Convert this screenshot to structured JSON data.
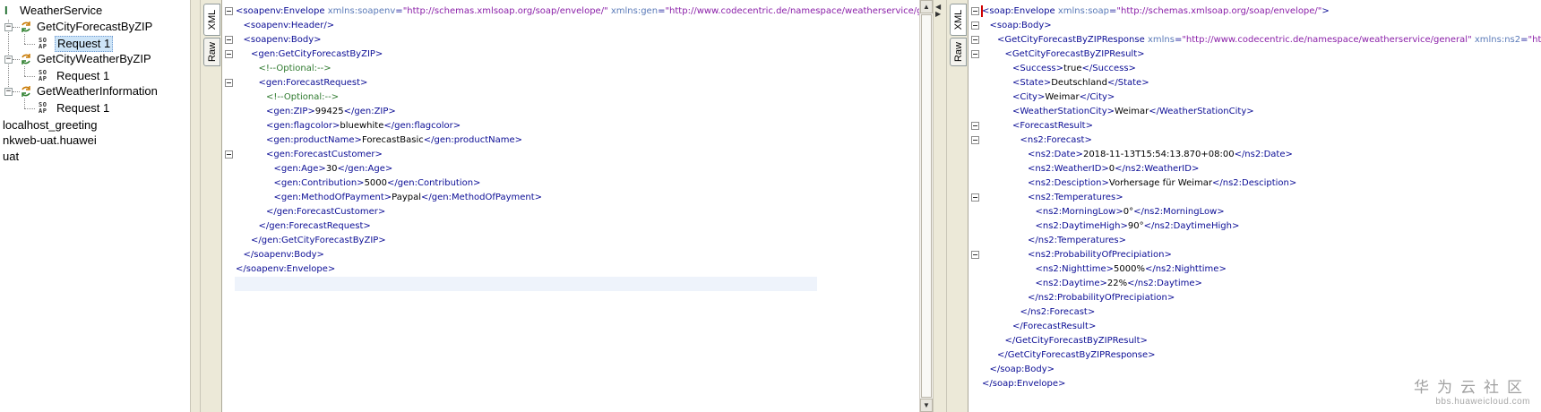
{
  "navigator": {
    "service": "WeatherService",
    "operations": [
      {
        "name": "GetCityForecastByZIP",
        "request": "Request 1",
        "selected": true
      },
      {
        "name": "GetCityWeatherByZIP",
        "request": "Request 1",
        "selected": false
      },
      {
        "name": "GetWeatherInformation",
        "request": "Request 1",
        "selected": false
      }
    ],
    "projects": [
      "localhost_greeting",
      "nkweb-uat.huawei",
      "uat"
    ],
    "icons": {
      "service": "service-icon",
      "operation": "operation-icon",
      "request": "soap-request-icon"
    }
  },
  "tabs": {
    "xml": "XML",
    "raw": "Raw"
  },
  "request_xml": [
    {
      "indent": 0,
      "fold": true,
      "parts": [
        [
          "t",
          "<soapenv:Envelope "
        ],
        [
          "an",
          "xmlns:soapenv"
        ],
        [
          "t",
          "="
        ],
        [
          "av",
          "\"http://schemas.xmlsoap.org/soap/envelope/\""
        ],
        [
          "tx",
          " "
        ],
        [
          "an",
          "xmlns:gen"
        ],
        [
          "t",
          "="
        ],
        [
          "av",
          "\"http://www.codecentric.de/namespace/weatherservice/general"
        ]
      ]
    },
    {
      "indent": 1,
      "fold": false,
      "parts": [
        [
          "t",
          "<soapenv:Header/>"
        ]
      ]
    },
    {
      "indent": 1,
      "fold": true,
      "parts": [
        [
          "t",
          "<soapenv:Body>"
        ]
      ]
    },
    {
      "indent": 2,
      "fold": true,
      "parts": [
        [
          "t",
          "<gen:GetCityForecastByZIP>"
        ]
      ]
    },
    {
      "indent": 3,
      "fold": false,
      "parts": [
        [
          "cm",
          "<!--Optional:-->"
        ]
      ]
    },
    {
      "indent": 3,
      "fold": true,
      "parts": [
        [
          "t",
          "<gen:ForecastRequest>"
        ]
      ]
    },
    {
      "indent": 4,
      "fold": false,
      "parts": [
        [
          "cm",
          "<!--Optional:-->"
        ]
      ]
    },
    {
      "indent": 4,
      "fold": false,
      "parts": [
        [
          "t",
          "<gen:ZIP>"
        ],
        [
          "tx",
          "99425"
        ],
        [
          "t",
          "</gen:ZIP>"
        ]
      ]
    },
    {
      "indent": 4,
      "fold": false,
      "parts": [
        [
          "t",
          "<gen:flagcolor>"
        ],
        [
          "tx",
          "bluewhite"
        ],
        [
          "t",
          "</gen:flagcolor>"
        ]
      ]
    },
    {
      "indent": 4,
      "fold": false,
      "parts": [
        [
          "t",
          "<gen:productName>"
        ],
        [
          "tx",
          "ForecastBasic"
        ],
        [
          "t",
          "</gen:productName>"
        ]
      ]
    },
    {
      "indent": 4,
      "fold": true,
      "parts": [
        [
          "t",
          "<gen:ForecastCustomer>"
        ]
      ]
    },
    {
      "indent": 5,
      "fold": false,
      "parts": [
        [
          "t",
          "<gen:Age>"
        ],
        [
          "tx",
          "30"
        ],
        [
          "t",
          "</gen:Age>"
        ]
      ]
    },
    {
      "indent": 5,
      "fold": false,
      "parts": [
        [
          "t",
          "<gen:Contribution>"
        ],
        [
          "tx",
          "5000"
        ],
        [
          "t",
          "</gen:Contribution>"
        ]
      ]
    },
    {
      "indent": 5,
      "fold": false,
      "parts": [
        [
          "t",
          "<gen:MethodOfPayment>"
        ],
        [
          "tx",
          "Paypal"
        ],
        [
          "t",
          "</gen:MethodOfPayment>"
        ]
      ]
    },
    {
      "indent": 4,
      "fold": false,
      "parts": [
        [
          "t",
          "</gen:ForecastCustomer>"
        ]
      ]
    },
    {
      "indent": 3,
      "fold": false,
      "parts": [
        [
          "t",
          "</gen:ForecastRequest>"
        ]
      ]
    },
    {
      "indent": 2,
      "fold": false,
      "parts": [
        [
          "t",
          "</gen:GetCityForecastByZIP>"
        ]
      ]
    },
    {
      "indent": 1,
      "fold": false,
      "parts": [
        [
          "t",
          "</soapenv:Body>"
        ]
      ]
    },
    {
      "indent": 0,
      "fold": false,
      "parts": [
        [
          "t",
          "</soapenv:Envelope>"
        ]
      ]
    }
  ],
  "response_xml": [
    {
      "indent": 0,
      "fold": true,
      "parts": [
        [
          "t",
          "<soap:Envelope "
        ],
        [
          "an",
          "xmlns:soap"
        ],
        [
          "t",
          "="
        ],
        [
          "av",
          "\"http://schemas.xmlsoap.org/soap/envelope/\""
        ],
        [
          "t",
          ">"
        ]
      ]
    },
    {
      "indent": 1,
      "fold": true,
      "parts": [
        [
          "t",
          "<soap:Body>"
        ]
      ]
    },
    {
      "indent": 2,
      "fold": true,
      "parts": [
        [
          "t",
          "<GetCityForecastByZIPResponse "
        ],
        [
          "an",
          "xmlns"
        ],
        [
          "t",
          "="
        ],
        [
          "av",
          "\"http://www.codecentric.de/namespace/weatherservice/general\""
        ],
        [
          "tx",
          " "
        ],
        [
          "an",
          "xmlns:ns2"
        ],
        [
          "t",
          "="
        ],
        [
          "av",
          "\"http://"
        ]
      ]
    },
    {
      "indent": 3,
      "fold": true,
      "parts": [
        [
          "t",
          "<GetCityForecastByZIPResult>"
        ]
      ]
    },
    {
      "indent": 4,
      "fold": false,
      "parts": [
        [
          "t",
          "<Success>"
        ],
        [
          "tx",
          "true"
        ],
        [
          "t",
          "</Success>"
        ]
      ]
    },
    {
      "indent": 4,
      "fold": false,
      "parts": [
        [
          "t",
          "<State>"
        ],
        [
          "tx",
          "Deutschland"
        ],
        [
          "t",
          "</State>"
        ]
      ]
    },
    {
      "indent": 4,
      "fold": false,
      "parts": [
        [
          "t",
          "<City>"
        ],
        [
          "tx",
          "Weimar"
        ],
        [
          "t",
          "</City>"
        ]
      ]
    },
    {
      "indent": 4,
      "fold": false,
      "parts": [
        [
          "t",
          "<WeatherStationCity>"
        ],
        [
          "tx",
          "Weimar"
        ],
        [
          "t",
          "</WeatherStationCity>"
        ]
      ]
    },
    {
      "indent": 4,
      "fold": true,
      "parts": [
        [
          "t",
          "<ForecastResult>"
        ]
      ]
    },
    {
      "indent": 5,
      "fold": true,
      "parts": [
        [
          "t",
          "<ns2:Forecast>"
        ]
      ]
    },
    {
      "indent": 6,
      "fold": false,
      "parts": [
        [
          "t",
          "<ns2:Date>"
        ],
        [
          "tx",
          "2018-11-13T15:54:13.870+08:00"
        ],
        [
          "t",
          "</ns2:Date>"
        ]
      ]
    },
    {
      "indent": 6,
      "fold": false,
      "parts": [
        [
          "t",
          "<ns2:WeatherID>"
        ],
        [
          "tx",
          "0"
        ],
        [
          "t",
          "</ns2:WeatherID>"
        ]
      ]
    },
    {
      "indent": 6,
      "fold": false,
      "parts": [
        [
          "t",
          "<ns2:Desciption>"
        ],
        [
          "tx",
          "Vorhersage für Weimar"
        ],
        [
          "t",
          "</ns2:Desciption>"
        ]
      ]
    },
    {
      "indent": 6,
      "fold": true,
      "parts": [
        [
          "t",
          "<ns2:Temperatures>"
        ]
      ]
    },
    {
      "indent": 7,
      "fold": false,
      "parts": [
        [
          "t",
          "<ns2:MorningLow>"
        ],
        [
          "tx",
          "0°"
        ],
        [
          "t",
          "</ns2:MorningLow>"
        ]
      ]
    },
    {
      "indent": 7,
      "fold": false,
      "parts": [
        [
          "t",
          "<ns2:DaytimeHigh>"
        ],
        [
          "tx",
          "90°"
        ],
        [
          "t",
          "</ns2:DaytimeHigh>"
        ]
      ]
    },
    {
      "indent": 6,
      "fold": false,
      "parts": [
        [
          "t",
          "</ns2:Temperatures>"
        ]
      ]
    },
    {
      "indent": 6,
      "fold": true,
      "parts": [
        [
          "t",
          "<ns2:ProbabilityOfPrecipiation>"
        ]
      ]
    },
    {
      "indent": 7,
      "fold": false,
      "parts": [
        [
          "t",
          "<ns2:Nighttime>"
        ],
        [
          "tx",
          "5000%"
        ],
        [
          "t",
          "</ns2:Nighttime>"
        ]
      ]
    },
    {
      "indent": 7,
      "fold": false,
      "parts": [
        [
          "t",
          "<ns2:Daytime>"
        ],
        [
          "tx",
          "22%"
        ],
        [
          "t",
          "</ns2:Daytime>"
        ]
      ]
    },
    {
      "indent": 6,
      "fold": false,
      "parts": [
        [
          "t",
          "</ns2:ProbabilityOfPrecipiation>"
        ]
      ]
    },
    {
      "indent": 5,
      "fold": false,
      "parts": [
        [
          "t",
          "</ns2:Forecast>"
        ]
      ]
    },
    {
      "indent": 4,
      "fold": false,
      "parts": [
        [
          "t",
          "</ForecastResult>"
        ]
      ]
    },
    {
      "indent": 3,
      "fold": false,
      "parts": [
        [
          "t",
          "</GetCityForecastByZIPResult>"
        ]
      ]
    },
    {
      "indent": 2,
      "fold": false,
      "parts": [
        [
          "t",
          "</GetCityForecastByZIPResponse>"
        ]
      ]
    },
    {
      "indent": 1,
      "fold": false,
      "parts": [
        [
          "t",
          "</soap:Body>"
        ]
      ]
    },
    {
      "indent": 0,
      "fold": false,
      "parts": [
        [
          "t",
          "</soap:Envelope>"
        ]
      ]
    }
  ],
  "watermark": {
    "title": "华为云社区",
    "subtitle": "bbs.huaweicloud.com"
  }
}
